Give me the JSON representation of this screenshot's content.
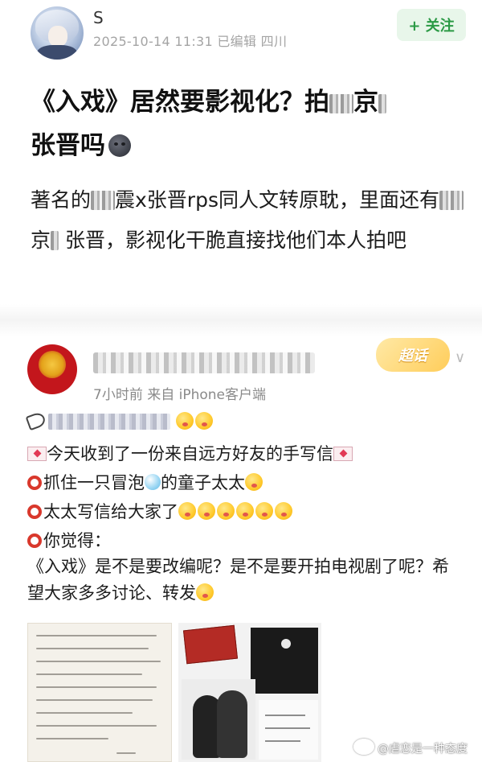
{
  "post": {
    "username": "S",
    "meta": "2025-10-14 11:31 已编辑 四川",
    "follow_label": "+ 关注",
    "title_part1": "《入戏》居然要影视化？拍",
    "title_part2": "京",
    "title_part3": "张晋吗",
    "body_part1": "著名的",
    "body_part2": "震x张晋rps同人文转原耽，里面还有",
    "body_part3": "京",
    "body_part4": " 张晋，影视化干脆直接找他们本人拍吧"
  },
  "embedded": {
    "meta": "7小时前  来自 iPhone客户端",
    "supertopic_label": "超话",
    "line1": "今天收到了一份来自远方好友的手写信",
    "line2_a": "抓住一只冒泡",
    "line2_b": "的童子太太",
    "line3": "太太写信给大家了",
    "line4": "你觉得：",
    "paragraph": "《入戏》是不是要改编呢？是不是要开拍电视剧了呢？希望大家多多讨论、转发"
  },
  "watermark": "@虐恋是一种态度",
  "colors": {
    "follow_bg": "#e8f6ea",
    "follow_text": "#2b9a45",
    "ring": "#d9382c",
    "avatar_red": "#c3161c"
  }
}
